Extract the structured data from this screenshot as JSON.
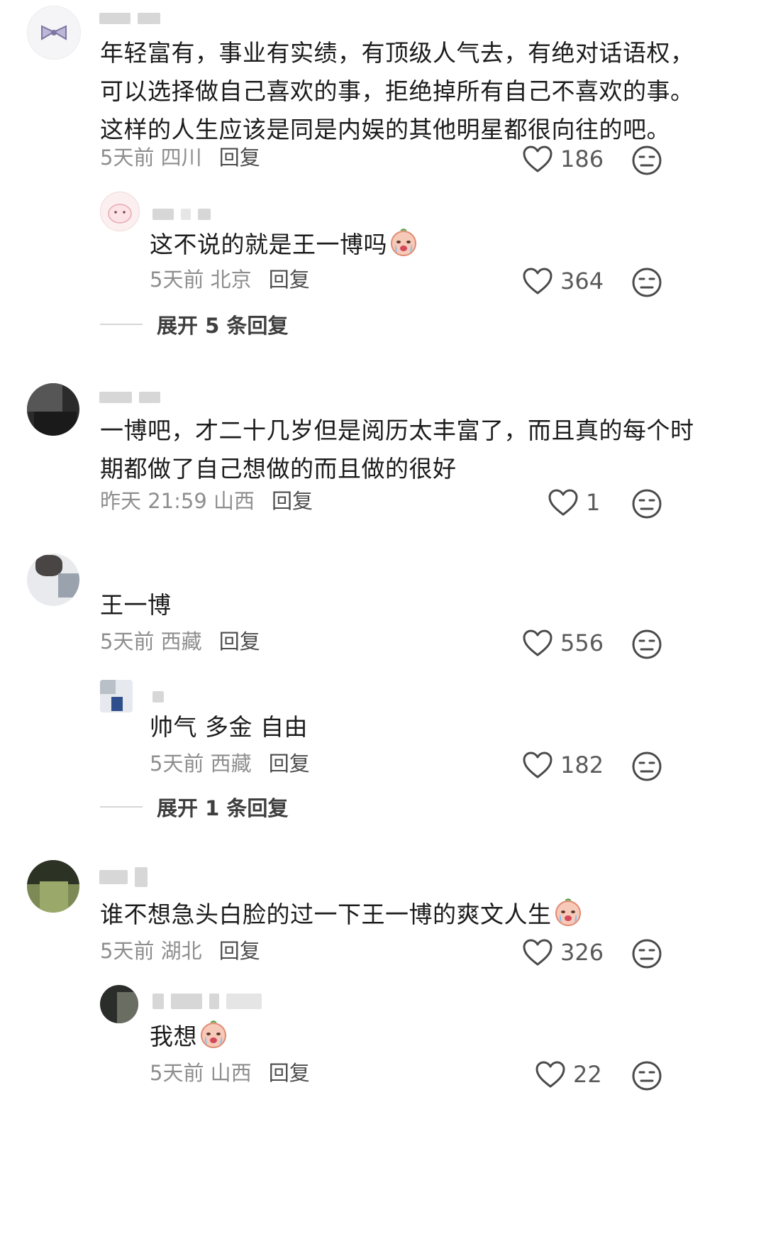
{
  "comments": [
    {
      "text_lines": [
        "年轻富有，事业有实绩，有顶级人气去，有绝对话语权，",
        "可以选择做自己喜欢的事，拒绝掉所有自己不喜欢的事。",
        "这样的人生应该是同是内娱的其他明星都很向往的吧。"
      ],
      "time": "5天前",
      "location": "四川",
      "reply_label": "回复",
      "likes": "186",
      "replies": [
        {
          "text": "这不说的就是王一博吗",
          "time": "5天前",
          "location": "北京",
          "reply_label": "回复",
          "likes": "364"
        }
      ],
      "expand_label": "展开 5 条回复"
    },
    {
      "text_lines": [
        "一博吧，才二十几岁但是阅历太丰富了，而且真的每个时",
        "期都做了自己想做的而且做的很好"
      ],
      "time": "昨天 21:59",
      "location": "山西",
      "reply_label": "回复",
      "likes": "1"
    },
    {
      "text_lines": [
        "王一博"
      ],
      "time": "5天前",
      "location": "西藏",
      "reply_label": "回复",
      "likes": "556",
      "replies": [
        {
          "text": "帅气 多金 自由",
          "time": "5天前",
          "location": "西藏",
          "reply_label": "回复",
          "likes": "182"
        }
      ],
      "expand_label": "展开 1 条回复"
    },
    {
      "text_lines": [
        "谁不想急头白脸的过一下王一博的爽文人生"
      ],
      "time": "5天前",
      "location": "湖北",
      "reply_label": "回复",
      "likes": "326",
      "replies": [
        {
          "text": "我想",
          "time": "5天前",
          "location": "山西",
          "reply_label": "回复",
          "likes": "22"
        }
      ]
    }
  ],
  "colors": {
    "text": "#1c1c1c",
    "meta": "#8e8e8e",
    "icon": "#4a4a4a"
  },
  "icons": [
    "heart-icon",
    "dislike-face-icon",
    "crying-emoji-icon"
  ]
}
